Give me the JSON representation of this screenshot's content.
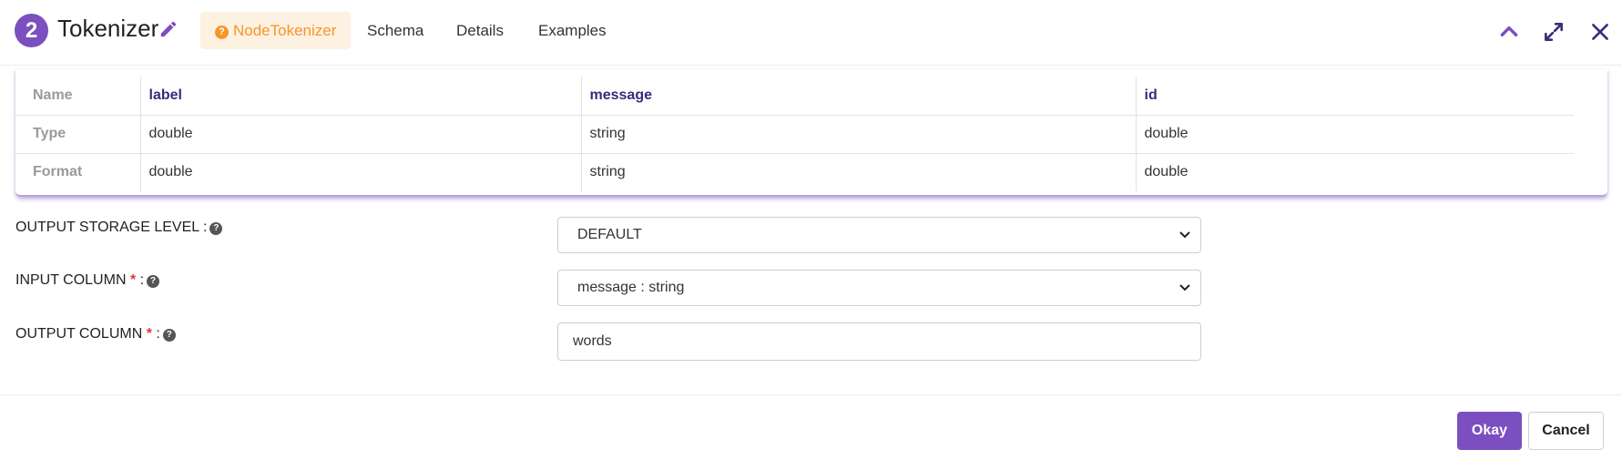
{
  "header": {
    "step_number": "2",
    "title": "Tokenizer",
    "tabs": [
      {
        "label": "NodeTokenizer",
        "active": true
      },
      {
        "label": "Schema",
        "active": false
      },
      {
        "label": "Details",
        "active": false
      },
      {
        "label": "Examples",
        "active": false
      }
    ],
    "actions": [
      "chevron-up-icon",
      "expand-icon",
      "close-icon"
    ]
  },
  "schema": {
    "row_headers": [
      "Name",
      "Type",
      "Format"
    ],
    "columns": [
      {
        "name": "label",
        "type": "double",
        "format": "double"
      },
      {
        "name": "message",
        "type": "string",
        "format": "string"
      },
      {
        "name": "id",
        "type": "double",
        "format": "double"
      }
    ]
  },
  "form": {
    "output_storage_level": {
      "label": "OUTPUT STORAGE LEVEL :",
      "required": false,
      "value": "DEFAULT"
    },
    "input_column": {
      "label": "INPUT COLUMN",
      "required_mark": "*",
      "suffix": ":",
      "value": "message : string"
    },
    "output_column": {
      "label": "OUTPUT COLUMN",
      "required_mark": "*",
      "suffix": ":",
      "value": "words"
    }
  },
  "footer": {
    "ok_label": "Okay",
    "cancel_label": "Cancel"
  },
  "colors": {
    "accent": "#7b4fbf",
    "tab_active_text": "#f5962a",
    "tab_active_bg": "#fdf1e1",
    "required": "#e53935"
  }
}
